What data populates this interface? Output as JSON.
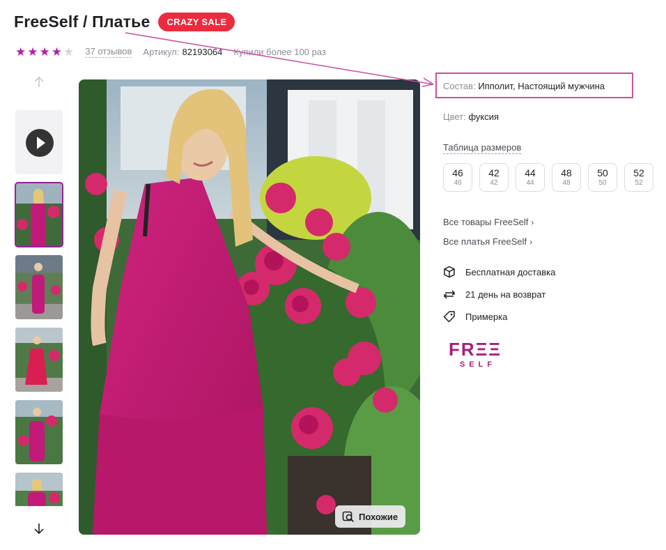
{
  "product": {
    "title": "FreeSelf / Платье",
    "sale_badge": "CRAZY SALE",
    "rating_stars": 4,
    "reviews": "37 отзывов",
    "article_label": "Артикул:",
    "article_value": "82193064",
    "bought": "Купили более 100 раз"
  },
  "gallery": {
    "similar_button": "Похожие",
    "thumbnail_count": 6,
    "selected_index": 1
  },
  "details": {
    "composition_label": "Состав:",
    "composition_value": "Ипполит, Настоящий мужчина",
    "color_label": "Цвет:",
    "color_value": "фуксия",
    "size_table": "Таблица размеров",
    "sizes": [
      {
        "main": "46",
        "sub": "46"
      },
      {
        "main": "42",
        "sub": "42"
      },
      {
        "main": "44",
        "sub": "44"
      },
      {
        "main": "48",
        "sub": "48"
      },
      {
        "main": "50",
        "sub": "50"
      },
      {
        "main": "52",
        "sub": "52"
      }
    ],
    "all_brand": "Все товары FreeSelf",
    "all_dresses": "Все платья FreeSelf",
    "delivery": "Бесплатная доставка",
    "return": "21 день на возврат",
    "fitting": "Примерка"
  },
  "logo": {
    "top": "FREE",
    "bottom": "SELF"
  },
  "colors": {
    "accent": "#b21fa8",
    "sale": "#ec2b3e",
    "dress": "#c21a78",
    "annotation": "#c94ea3"
  }
}
